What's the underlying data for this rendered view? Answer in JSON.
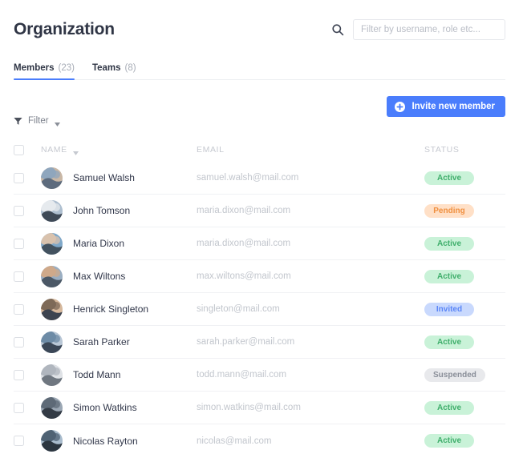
{
  "header": {
    "title": "Organization",
    "search_icon": "search-icon",
    "search_placeholder": "Filter by username, role etc...",
    "search_value": ""
  },
  "tabs": [
    {
      "label": "Members",
      "count": "(23)",
      "active": true
    },
    {
      "label": "Teams",
      "count": "(8)",
      "active": false
    }
  ],
  "toolbar": {
    "invite_label": "Invite new member",
    "invite_icon": "plus-circle-icon",
    "filter_label": "Filter",
    "filter_icon": "funnel-icon",
    "filter_caret_icon": "chevron-down-icon"
  },
  "table": {
    "columns": {
      "name": "NAME",
      "email": "EMAIL",
      "status": "STATUS",
      "sort_icon": "chevron-down-icon"
    },
    "rows": [
      {
        "name": "Samuel Walsh",
        "email": "samuel.walsh@mail.com",
        "status": "Active",
        "status_kind": "active"
      },
      {
        "name": "John Tomson",
        "email": "maria.dixon@mail.com",
        "status": "Pending",
        "status_kind": "pending"
      },
      {
        "name": "Maria Dixon",
        "email": "maria.dixon@mail.com",
        "status": "Active",
        "status_kind": "active"
      },
      {
        "name": "Max Wiltons",
        "email": "max.wiltons@mail.com",
        "status": "Active",
        "status_kind": "active"
      },
      {
        "name": "Henrick Singleton",
        "email": "singleton@mail.com",
        "status": "Invited",
        "status_kind": "invited"
      },
      {
        "name": "Sarah Parker",
        "email": "sarah.parker@mail.com",
        "status": "Active",
        "status_kind": "active"
      },
      {
        "name": "Todd Mann",
        "email": "todd.mann@mail.com",
        "status": "Suspended",
        "status_kind": "suspended"
      },
      {
        "name": "Simon Watkins",
        "email": "simon.watkins@mail.com",
        "status": "Active",
        "status_kind": "active"
      },
      {
        "name": "Nicolas Rayton",
        "email": "nicolas@mail.com",
        "status": "Active",
        "status_kind": "active"
      }
    ]
  },
  "colors": {
    "accent": "#4a7dfc",
    "title": "#2f3545",
    "muted": "#c2c6cd",
    "active_bg": "#c9f2d8",
    "active_fg": "#3fae6b",
    "pending_bg": "#ffe0c7",
    "pending_fg": "#f09040",
    "invited_bg": "#c9d9fd",
    "invited_fg": "#5b86f7",
    "suspended_bg": "#e8e9ec",
    "suspended_fg": "#8a8f99"
  },
  "avatar_palettes": [
    [
      "#c9b7a5",
      "#8fa6bd",
      "#5d6b7d"
    ],
    [
      "#aebfd0",
      "#e6eaee",
      "#3f4a57"
    ],
    [
      "#7fa8c9",
      "#d9c2ad",
      "#43525f"
    ],
    [
      "#9aaec2",
      "#cfa98a",
      "#4b5866"
    ],
    [
      "#d6b89c",
      "#7e6a58",
      "#3d4450"
    ],
    [
      "#b9c7d6",
      "#6d8ba6",
      "#3b4757"
    ],
    [
      "#dfe2e6",
      "#b0b6be",
      "#6f7780"
    ],
    [
      "#9ba7b4",
      "#5e6a77",
      "#333b45"
    ],
    [
      "#a9bccd",
      "#4f6274",
      "#2c3640"
    ]
  ]
}
